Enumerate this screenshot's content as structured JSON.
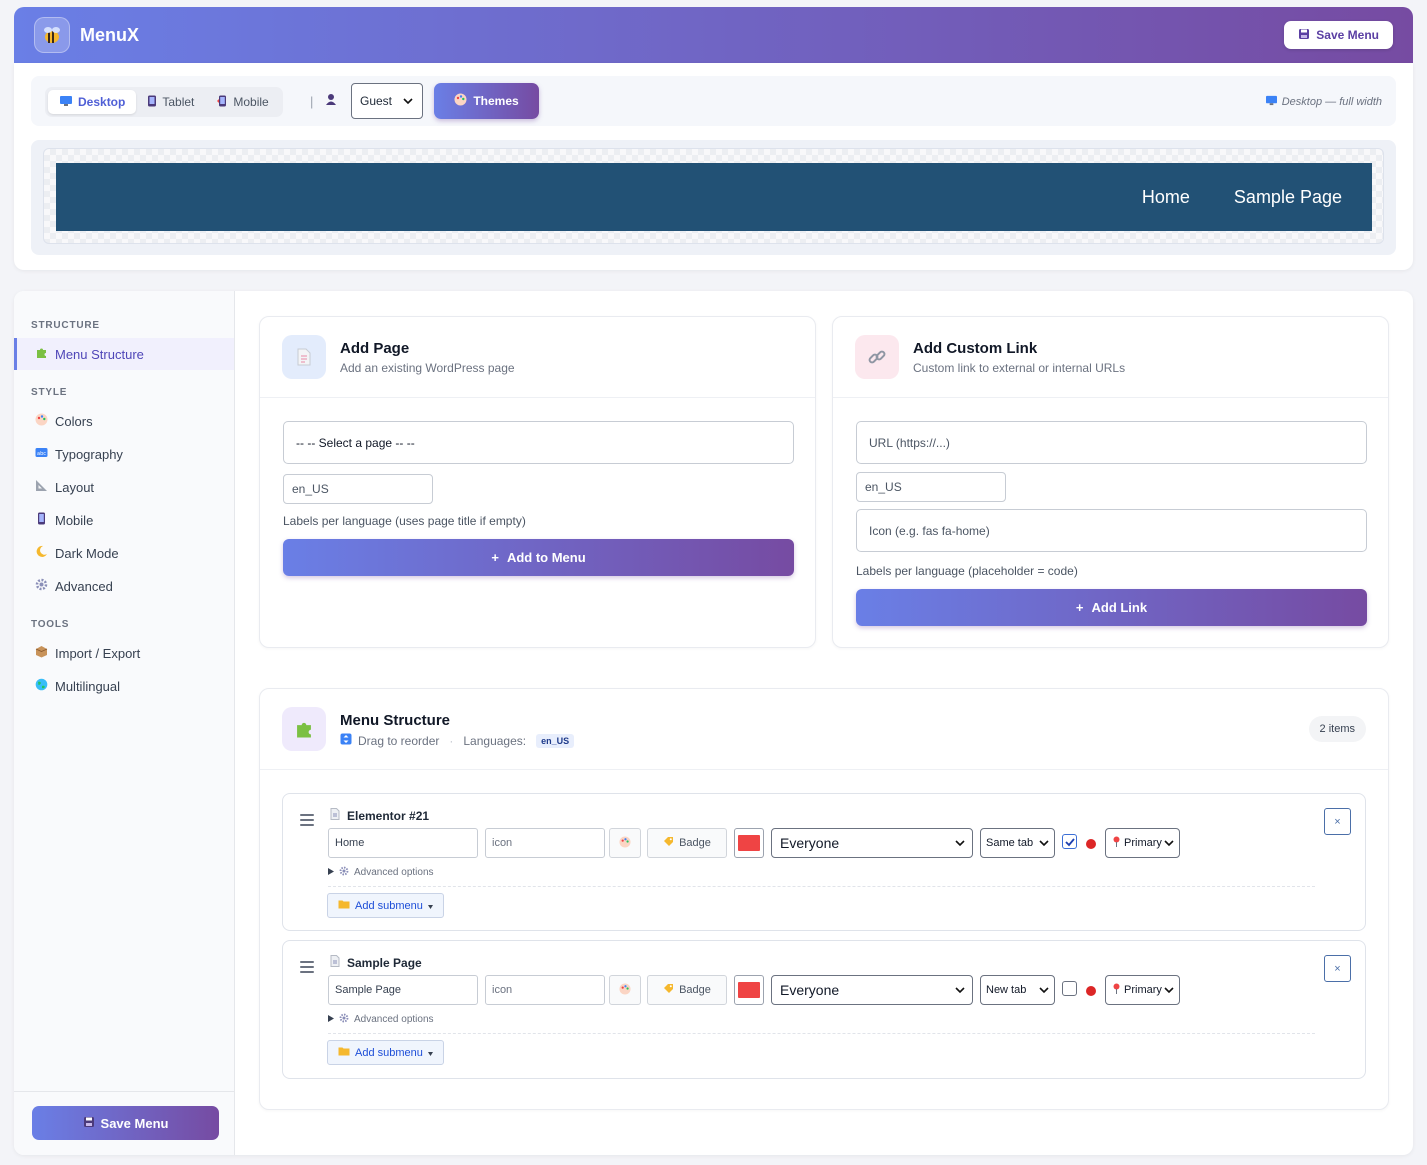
{
  "app": {
    "title": "MenuX",
    "save_label": "Save Menu"
  },
  "preview": {
    "devices": [
      {
        "label": "Desktop",
        "active": true
      },
      {
        "label": "Tablet",
        "active": false
      },
      {
        "label": "Mobile",
        "active": false
      }
    ],
    "separator": "|",
    "role_select": "Guest",
    "themes_label": "Themes",
    "device_note": "Desktop — full width",
    "nav_items": [
      "Home",
      "Sample Page"
    ],
    "nav_bg": "#225175"
  },
  "sidebar": {
    "sections": [
      {
        "title": "STRUCTURE",
        "items": [
          {
            "label": "Menu Structure",
            "icon": "puzzle-icon",
            "active": true
          }
        ]
      },
      {
        "title": "STYLE",
        "items": [
          {
            "label": "Colors",
            "icon": "palette-icon"
          },
          {
            "label": "Typography",
            "icon": "abc-icon"
          },
          {
            "label": "Layout",
            "icon": "ruler-icon"
          },
          {
            "label": "Mobile",
            "icon": "phone-icon"
          },
          {
            "label": "Dark Mode",
            "icon": "moon-icon"
          },
          {
            "label": "Advanced",
            "icon": "gear-icon"
          }
        ]
      },
      {
        "title": "TOOLS",
        "items": [
          {
            "label": "Import / Export",
            "icon": "package-icon"
          },
          {
            "label": "Multilingual",
            "icon": "globe-icon"
          }
        ]
      }
    ],
    "save_label": "Save Menu"
  },
  "add_page": {
    "title": "Add Page",
    "subtitle": "Add an existing WordPress page",
    "select_value": "-- -- Select a page -- --",
    "lang_placeholder": "en_US",
    "hint": "Labels per language (uses page title if empty)",
    "button": "Add to Menu"
  },
  "add_link": {
    "title": "Add Custom Link",
    "subtitle": "Custom link to external or internal URLs",
    "url_placeholder": "URL (https://...)",
    "lang_placeholder": "en_US",
    "icon_placeholder": "Icon (e.g. fas fa-home)",
    "hint": "Labels per language (placeholder = code)",
    "button": "Add Link"
  },
  "menu_structure": {
    "title": "Menu Structure",
    "drag_hint": "Drag to reorder",
    "dot_sep": "·",
    "languages_label": "Languages:",
    "language": "en_US",
    "count": "2 items",
    "items": [
      {
        "title": "Elementor #21",
        "label": "Home",
        "icon_placeholder": "icon",
        "badge": "Badge",
        "color": "#ef4444",
        "visibility": "Everyone",
        "target": "Same tab",
        "checked": true,
        "location": "Primary",
        "advanced": "Advanced options",
        "add_submenu": "Add submenu",
        "remove": "×"
      },
      {
        "title": "Sample Page",
        "label": "Sample Page",
        "icon_placeholder": "icon",
        "badge": "Badge",
        "color": "#ef4444",
        "visibility": "Everyone",
        "target": "New tab",
        "checked": false,
        "location": "Primary",
        "advanced": "Advanced options",
        "add_submenu": "Add submenu",
        "remove": "×"
      }
    ]
  }
}
